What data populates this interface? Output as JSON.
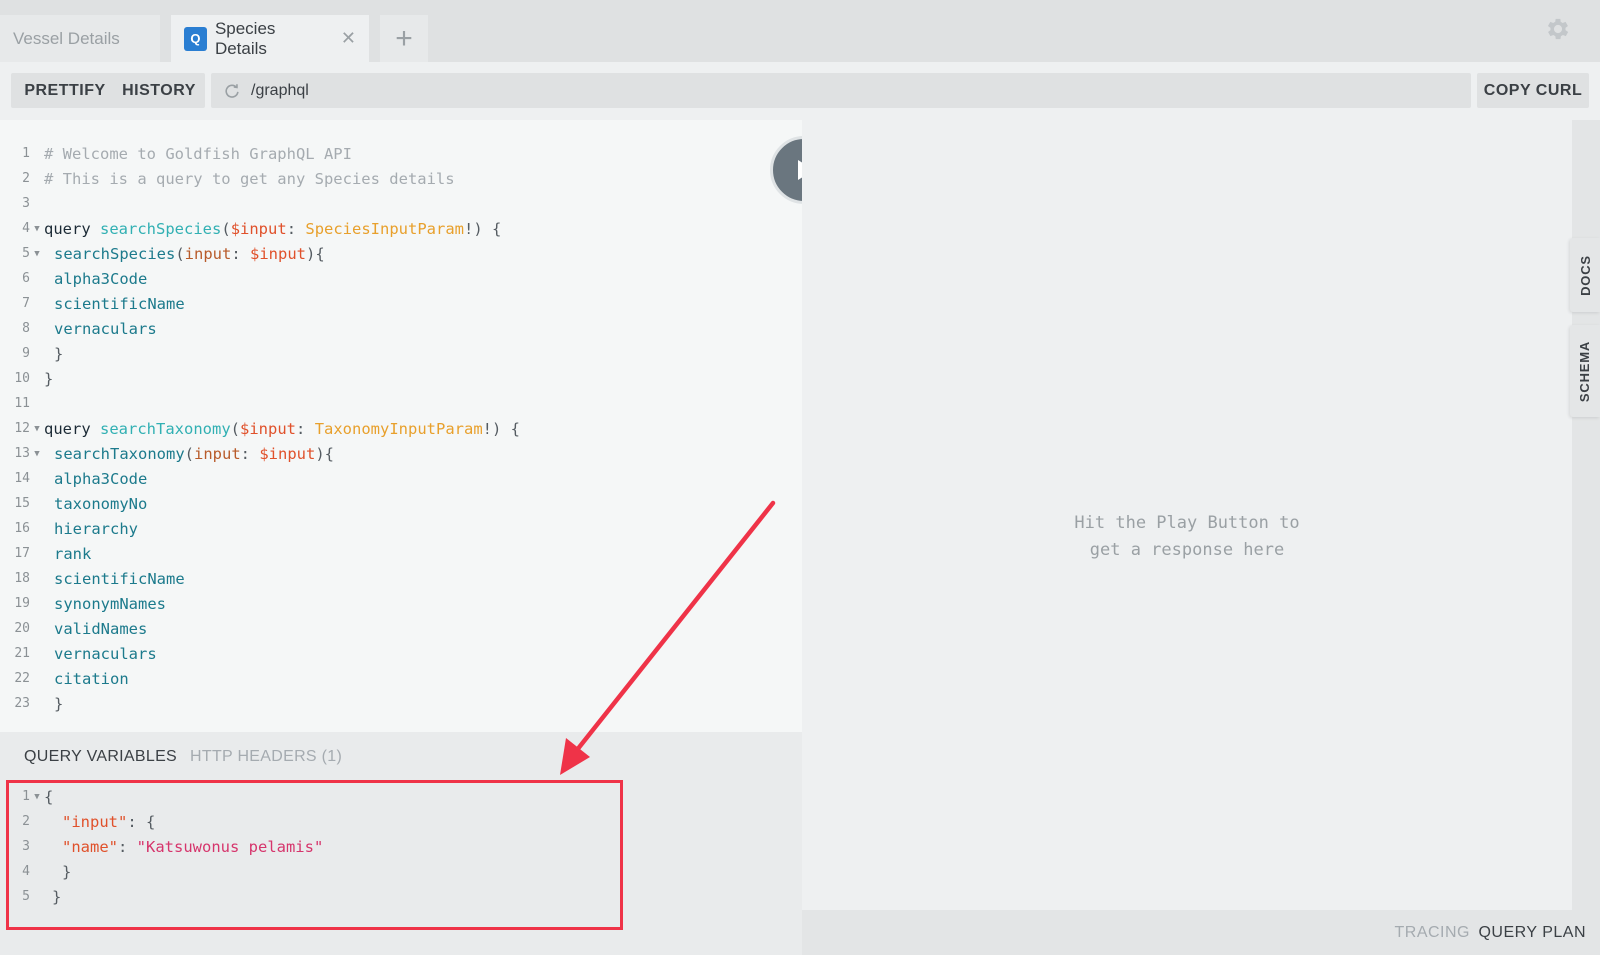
{
  "tabs": [
    {
      "label": "Vessel Details"
    },
    {
      "label": "Species Details",
      "badge": "Q"
    }
  ],
  "toolbar": {
    "prettify_label": "PRETTIFY",
    "history_label": "HISTORY",
    "endpoint": "/graphql",
    "copy_curl_label": "COPY CURL"
  },
  "editor": {
    "lines": [
      {
        "n": "1",
        "text": "# Welcome to Goldfish GraphQL API"
      },
      {
        "n": "2",
        "text": "# This is a query to get any Species details"
      },
      {
        "n": "3",
        "text": ""
      },
      {
        "n": "4",
        "text": "query searchSpecies($input: SpeciesInputParam!) {"
      },
      {
        "n": "5",
        "text": "searchSpecies(input: $input){"
      },
      {
        "n": "6",
        "text": "alpha3Code"
      },
      {
        "n": "7",
        "text": "scientificName"
      },
      {
        "n": "8",
        "text": "vernaculars"
      },
      {
        "n": "9",
        "text": "}"
      },
      {
        "n": "10",
        "text": "}"
      },
      {
        "n": "11",
        "text": ""
      },
      {
        "n": "12",
        "text": "query searchTaxonomy($input: TaxonomyInputParam!) {"
      },
      {
        "n": "13",
        "text": "searchTaxonomy(input: $input){"
      },
      {
        "n": "14",
        "text": "alpha3Code"
      },
      {
        "n": "15",
        "text": "taxonomyNo"
      },
      {
        "n": "16",
        "text": "hierarchy"
      },
      {
        "n": "17",
        "text": "rank"
      },
      {
        "n": "18",
        "text": "scientificName"
      },
      {
        "n": "19",
        "text": "synonymNames"
      },
      {
        "n": "20",
        "text": "validNames"
      },
      {
        "n": "21",
        "text": "vernaculars"
      },
      {
        "n": "22",
        "text": "citation"
      },
      {
        "n": "23",
        "text": "}"
      }
    ]
  },
  "variables": {
    "tab_query_variables": "QUERY VARIABLES",
    "tab_http_headers": "HTTP HEADERS (1)",
    "lines": [
      {
        "n": "1",
        "text": "{"
      },
      {
        "n": "2",
        "text": "\"input\": {"
      },
      {
        "n": "3",
        "text": "\"name\": \"Katsuwonus pelamis\""
      },
      {
        "n": "4",
        "text": "}"
      },
      {
        "n": "5",
        "text": "}"
      }
    ]
  },
  "result": {
    "placeholder_line1": "Hit the Play Button to",
    "placeholder_line2": "get a response here"
  },
  "side_tabs": {
    "docs": "DOCS",
    "schema": "SCHEMA"
  },
  "footer": {
    "tracing": "TRACING",
    "query_plan": "QUERY PLAN"
  },
  "colors": {
    "accent_blue": "#2a7ed2",
    "annotation_red": "#ef3348"
  }
}
